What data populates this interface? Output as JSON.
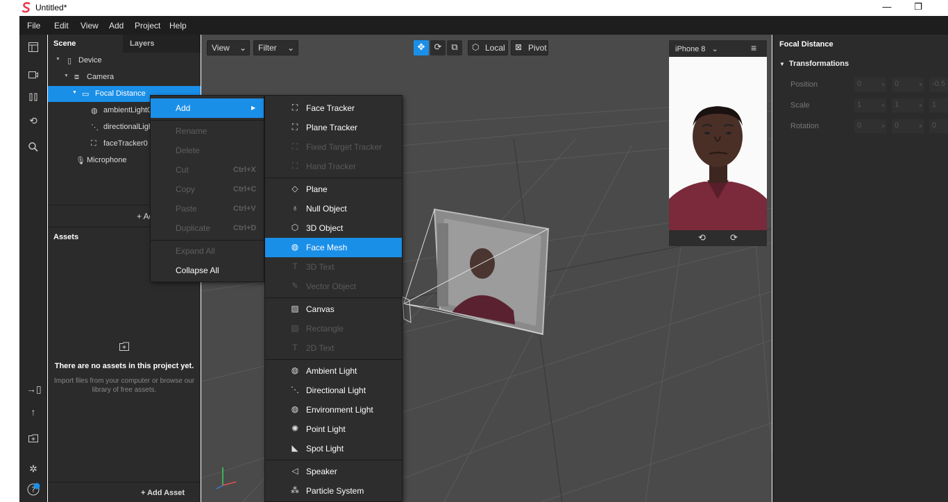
{
  "window": {
    "title": "Untitled*",
    "minimize": "—",
    "restore": "❐"
  },
  "menubar": {
    "items": [
      "File",
      "Edit",
      "View",
      "Add",
      "Project",
      "Help"
    ]
  },
  "scene_panel": {
    "tab_scene": "Scene",
    "tab_layers": "Layers",
    "tree": [
      {
        "label": "Device",
        "icon": "device-icon"
      },
      {
        "label": "Camera",
        "icon": "camera-icon"
      },
      {
        "label": "Focal Distance",
        "icon": "focal-distance-icon",
        "selected": true
      },
      {
        "label": "ambientLight0",
        "icon": "globe-icon"
      },
      {
        "label": "directionalLight0",
        "icon": "directional-light-icon"
      },
      {
        "label": "faceTracker0",
        "icon": "face-tracker-icon"
      },
      {
        "label": "Microphone",
        "icon": "microphone-icon"
      }
    ],
    "add_object": "+ Add Object"
  },
  "assets_panel": {
    "title": "Assets",
    "empty_title": "There are no assets in this project yet.",
    "empty_sub": "Import files from your computer or browse our library of free assets.",
    "add_asset": "+ Add Asset"
  },
  "viewport": {
    "view_label": "View",
    "filter_label": "Filter",
    "local_label": "Local",
    "pivot_label": "Pivot"
  },
  "simulator": {
    "device": "iPhone 8"
  },
  "inspector": {
    "title": "Focal Distance",
    "section": "Transformations",
    "rows": [
      {
        "label": "Position",
        "values": [
          "0",
          "0",
          "-0.5"
        ]
      },
      {
        "label": "Scale",
        "values": [
          "1",
          "1",
          "1"
        ]
      },
      {
        "label": "Rotation",
        "values": [
          "0",
          "0",
          "0"
        ]
      }
    ]
  },
  "context_menu": {
    "items": [
      {
        "label": "Add",
        "shortcut": "",
        "highlight": true,
        "disabled": false,
        "submenu": true
      },
      {
        "label": "Rename",
        "shortcut": "",
        "disabled": true
      },
      {
        "label": "Delete",
        "shortcut": "",
        "disabled": true
      },
      {
        "label": "Cut",
        "shortcut": "Ctrl+X",
        "disabled": true
      },
      {
        "label": "Copy",
        "shortcut": "Ctrl+C",
        "disabled": true
      },
      {
        "label": "Paste",
        "shortcut": "Ctrl+V",
        "disabled": true
      },
      {
        "label": "Duplicate",
        "shortcut": "Ctrl+D",
        "disabled": true
      },
      {
        "label": "Expand All",
        "shortcut": "",
        "disabled": true
      },
      {
        "label": "Collapse All",
        "shortcut": "",
        "disabled": false
      }
    ]
  },
  "add_submenu": {
    "items": [
      {
        "label": "Face Tracker",
        "icon": "face-tracker-icon",
        "disabled": false
      },
      {
        "label": "Plane Tracker",
        "icon": "plane-tracker-icon",
        "disabled": false
      },
      {
        "label": "Fixed Target Tracker",
        "icon": "target-tracker-icon",
        "disabled": true
      },
      {
        "label": "Hand Tracker",
        "icon": "hand-tracker-icon",
        "disabled": true
      },
      {
        "label": "Plane",
        "icon": "plane-icon",
        "disabled": false
      },
      {
        "label": "Null Object",
        "icon": "null-object-icon",
        "disabled": false
      },
      {
        "label": "3D Object",
        "icon": "cube-icon",
        "disabled": false
      },
      {
        "label": "Face Mesh",
        "icon": "globe-icon",
        "disabled": false,
        "highlight": true
      },
      {
        "label": "3D Text",
        "icon": "text-icon",
        "disabled": true
      },
      {
        "label": "Vector Object",
        "icon": "vector-icon",
        "disabled": true
      },
      {
        "label": "Canvas",
        "icon": "canvas-icon",
        "disabled": false
      },
      {
        "label": "Rectangle",
        "icon": "rectangle-icon",
        "disabled": true
      },
      {
        "label": "2D Text",
        "icon": "text-icon",
        "disabled": true
      },
      {
        "label": "Ambient Light",
        "icon": "globe-icon",
        "disabled": false
      },
      {
        "label": "Directional Light",
        "icon": "directional-light-icon",
        "disabled": false
      },
      {
        "label": "Environment Light",
        "icon": "globe-icon",
        "disabled": false
      },
      {
        "label": "Point Light",
        "icon": "point-light-icon",
        "disabled": false
      },
      {
        "label": "Spot Light",
        "icon": "spot-light-icon",
        "disabled": false
      },
      {
        "label": "Speaker",
        "icon": "speaker-icon",
        "disabled": false
      },
      {
        "label": "Particle System",
        "icon": "particle-icon",
        "disabled": false
      }
    ]
  },
  "colors": {
    "accent": "#1a8fe8",
    "panel": "#2b2b2b",
    "viewport": "#4a4a4a"
  }
}
